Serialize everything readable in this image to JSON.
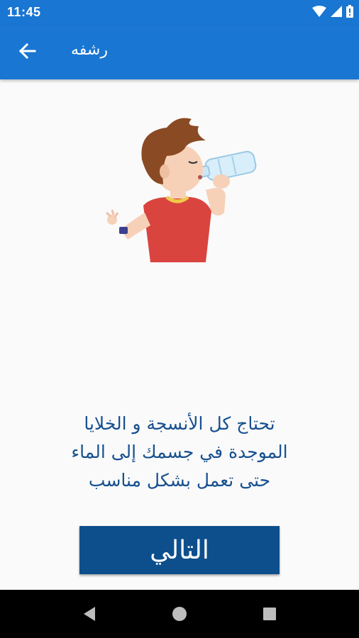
{
  "status_bar": {
    "time": "11:45",
    "icons": [
      "wifi-icon",
      "signal-icon",
      "battery-icon"
    ]
  },
  "app_bar": {
    "title": "رشفه",
    "back_icon": "arrow-back-icon",
    "background_color": "#1976d2"
  },
  "illustration": {
    "description_icon": "boy-drinking-water-icon"
  },
  "message": {
    "lines": [
      "تحتاج كل الأنسجة و الخلايا",
      "الموجدة في جسمك إلى الماء",
      "حتى تعمل بشكل مناسب"
    ],
    "color": "#17508f"
  },
  "next_button": {
    "label": "التالي",
    "background_color": "#0d4f8c"
  },
  "nav_bar": {
    "items": [
      "back-triangle-icon",
      "home-circle-icon",
      "recents-square-icon"
    ]
  }
}
